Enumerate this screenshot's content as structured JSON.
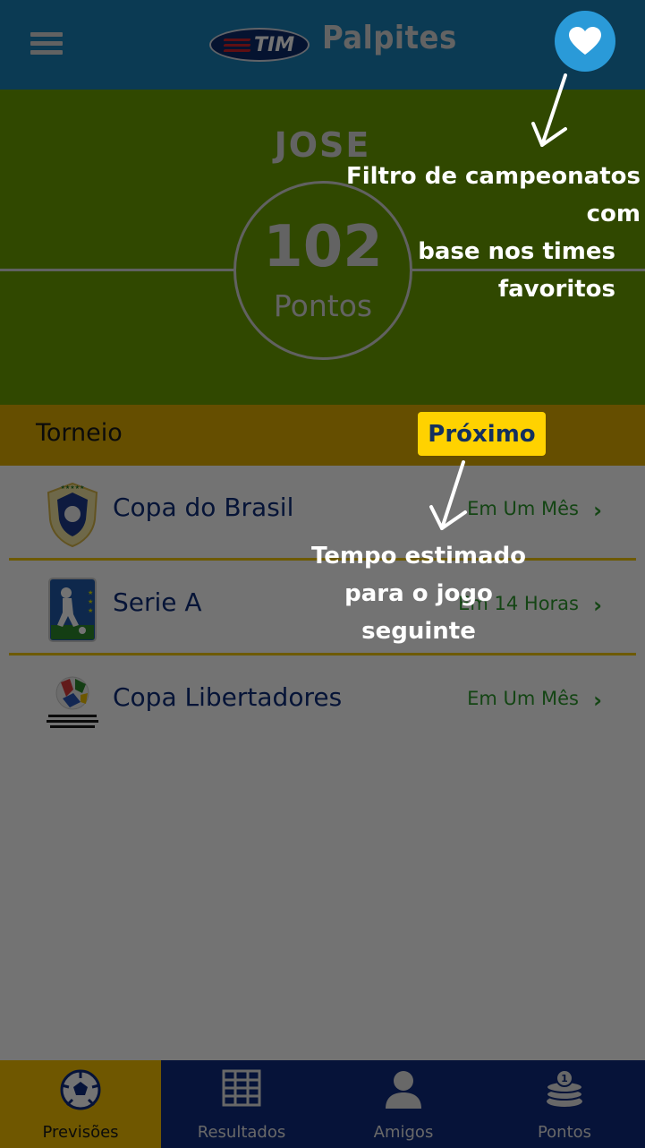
{
  "header": {
    "brand": "TIM",
    "title": "Palpites",
    "menu_icon": "hamburger-menu-icon",
    "favorite_icon": "heart-icon"
  },
  "profile": {
    "name": "JOSE",
    "points_value": "102",
    "points_label": "Pontos"
  },
  "section": {
    "title": "Torneio",
    "next_label": "Próximo"
  },
  "tournaments": [
    {
      "name": "Copa do Brasil",
      "time": "Em Um Mês",
      "logo": "copa-do-brasil-logo"
    },
    {
      "name": "Serie A",
      "time": "Em 14 Horas",
      "logo": "serie-a-logo"
    },
    {
      "name": "Copa Libertadores",
      "time": "Em Um Mês",
      "logo": "copa-libertadores-logo"
    }
  ],
  "nav": [
    {
      "label": "Previsões",
      "icon": "soccer-ball-icon",
      "active": true
    },
    {
      "label": "Resultados",
      "icon": "grid-table-icon",
      "active": false
    },
    {
      "label": "Amigos",
      "icon": "person-icon",
      "active": false
    },
    {
      "label": "Pontos",
      "icon": "coins-icon",
      "active": false
    }
  ],
  "annotations": {
    "favorites_line1": "Filtro de campeonatos com",
    "favorites_line2": "base nos times favoritos",
    "next_line1": "Tempo estimado",
    "next_line2": "para o jogo seguinte"
  },
  "colors": {
    "topbar": "#1a80b8",
    "hero": "#6ba000",
    "section_header": "#e0ae00",
    "badge": "#ffd200",
    "nav": "#0e2a7e",
    "nav_active": "#f5c200"
  }
}
